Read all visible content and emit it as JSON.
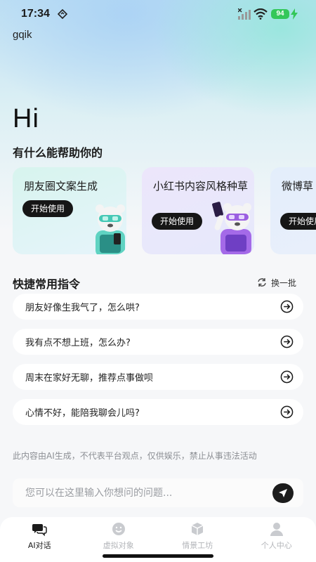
{
  "status_bar": {
    "time": "17:34",
    "battery": "94"
  },
  "app": {
    "name": "gqik"
  },
  "greeting": "Hi",
  "subtitle": "有什么能帮助你的",
  "cards": [
    {
      "title": "朋友圈文案生成",
      "button": "开始使用",
      "mascot": "bear-phone-mascot"
    },
    {
      "title": "小红书内容风格种草",
      "button": "开始使用",
      "mascot": "bear-selfie-mascot"
    },
    {
      "title": "微博草",
      "button": "开始使用"
    }
  ],
  "quick_commands": {
    "title": "快捷常用指令",
    "refresh_label": "换一批",
    "items": [
      "朋友好像生我气了，怎么哄?",
      "我有点不想上班，怎么办?",
      "周末在家好无聊，推荐点事做呗",
      "心情不好，能陪我聊会儿吗?"
    ]
  },
  "disclaimer": "此内容由AI生成，不代表平台观点，仅供娱乐，禁止从事违法活动",
  "chat_input": {
    "placeholder": "您可以在这里输入你想问的问题..."
  },
  "bottom_nav": [
    {
      "label": "AI对话",
      "icon": "chat-bubbles-icon",
      "active": true
    },
    {
      "label": "虚拟对象",
      "icon": "smiley-icon",
      "active": false
    },
    {
      "label": "情景工坊",
      "icon": "cube-icon",
      "active": false
    },
    {
      "label": "个人中心",
      "icon": "person-icon",
      "active": false
    }
  ],
  "colors": {
    "accent": "#161616",
    "card_1": "#d7f4ee",
    "card_2": "#ece6fb",
    "battery": "#34c759"
  }
}
